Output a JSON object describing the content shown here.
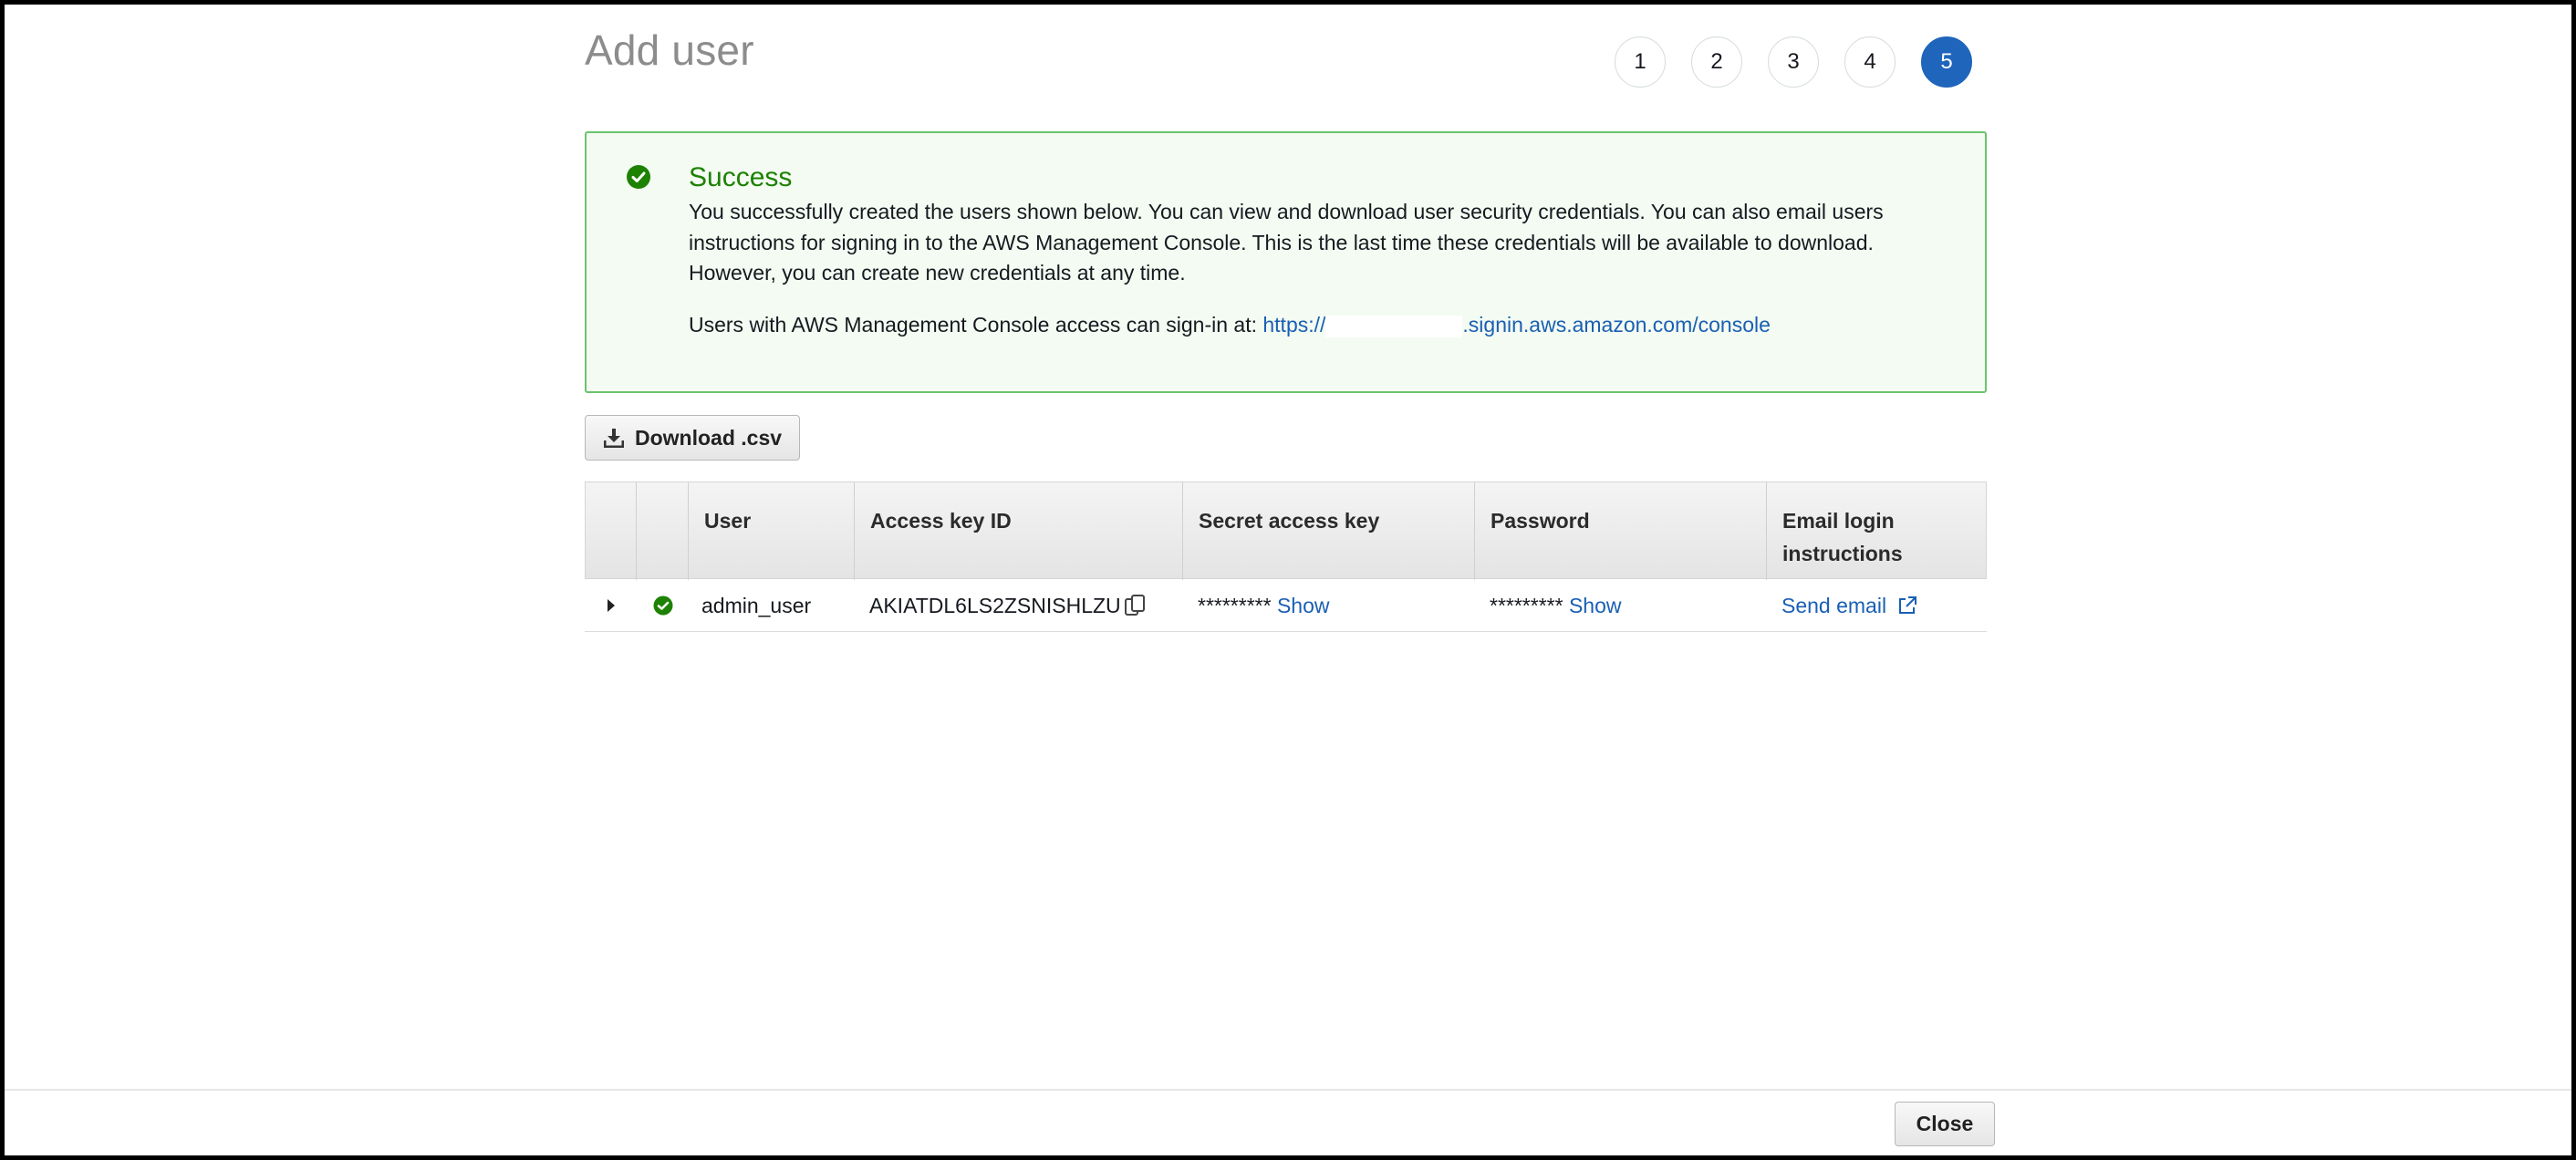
{
  "page": {
    "title": "Add user"
  },
  "steps": [
    "1",
    "2",
    "3",
    "4",
    "5"
  ],
  "success": {
    "title": "Success",
    "message": "You successfully created the users shown below. You can view and download user security credentials. You can also email users instructions for signing in to the AWS Management Console. This is the last time these credentials will be available to download. However, you can create new credentials at any time.",
    "signin_prefix": "Users with AWS Management Console access can sign-in at:",
    "signin_url_start": "https://",
    "signin_url_end": ".signin.aws.amazon.com/console"
  },
  "download_button": {
    "label": "Download .csv"
  },
  "table": {
    "headers": {
      "user": "User",
      "access_key_id": "Access key ID",
      "secret_access_key": "Secret access key",
      "password": "Password",
      "email_login_line1": "Email login",
      "email_login_line2": "instructions"
    },
    "rows": [
      {
        "user": "admin_user",
        "access_key_id": "AKIATDL6LS2ZSNISHLZU",
        "secret_mask": "*********",
        "secret_show": "Show",
        "password_mask": "*********",
        "password_show": "Show",
        "send_email": "Send email"
      }
    ]
  },
  "footer": {
    "close_label": "Close"
  },
  "colors": {
    "accent": "#1f65bb",
    "success": "#1d8102",
    "link": "#1a5fb4"
  }
}
